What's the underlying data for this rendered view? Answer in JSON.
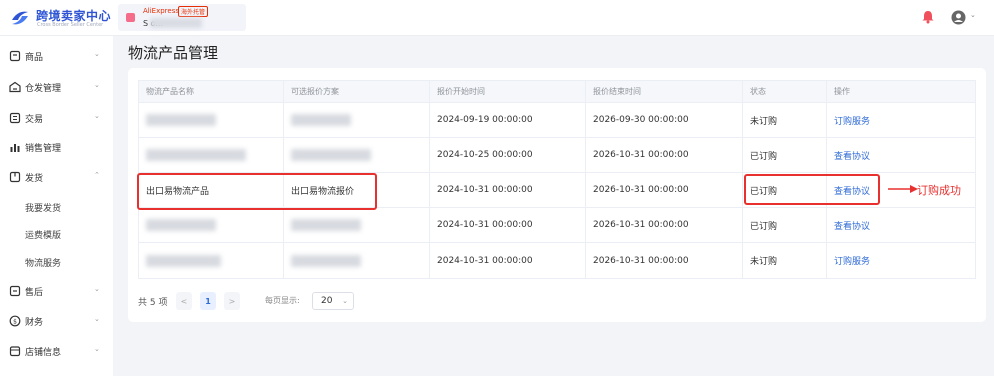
{
  "header": {
    "logo_title": "跨境卖家中心",
    "logo_sub": "Cross Border Seller Center",
    "store_brand": "AliExpress",
    "store_badge": "海外托管",
    "store_name": "S                 o..."
  },
  "sidebar": {
    "items": [
      {
        "label": "商品",
        "icon": "box-icon",
        "caret": "⌄"
      },
      {
        "label": "仓发管理",
        "icon": "warehouse-icon",
        "caret": "⌄"
      },
      {
        "label": "交易",
        "icon": "order-icon",
        "caret": "⌄"
      },
      {
        "label": "销售管理",
        "icon": "chart-icon",
        "caret": ""
      },
      {
        "label": "发货",
        "icon": "shipping-icon",
        "caret": "⌃"
      },
      {
        "label": "我要发货"
      },
      {
        "label": "运费模版"
      },
      {
        "label": "物流服务"
      },
      {
        "label": "售后",
        "icon": "aftersale-icon",
        "caret": "⌄"
      },
      {
        "label": "财务",
        "icon": "finance-icon",
        "caret": "⌄"
      },
      {
        "label": "店铺信息",
        "icon": "store-icon",
        "caret": "⌄"
      }
    ]
  },
  "page": {
    "title": "物流产品管理"
  },
  "table": {
    "columns": [
      "物流产品名称",
      "可选报价方案",
      "报价开始时间",
      "报价结束时间",
      "状态",
      "操作"
    ],
    "rows": [
      {
        "name": "",
        "plan": "",
        "start": "2024-09-19 00:00:00",
        "end": "2026-09-30 00:00:00",
        "status": "未订购",
        "action": "订购服务"
      },
      {
        "name": "",
        "plan": "",
        "start": "2024-10-25 00:00:00",
        "end": "2026-10-31 00:00:00",
        "status": "已订购",
        "action": "查看协议"
      },
      {
        "name": "出口易物流产品",
        "plan": "出口易物流报价",
        "start": "2024-10-31 00:00:00",
        "end": "2026-10-31 00:00:00",
        "status": "已订购",
        "action": "查看协议"
      },
      {
        "name": "",
        "plan": "",
        "start": "2024-10-31 00:00:00",
        "end": "2026-10-31 00:00:00",
        "status": "已订购",
        "action": "查看协议"
      },
      {
        "name": "",
        "plan": "",
        "start": "2024-10-31 00:00:00",
        "end": "2026-10-31 00:00:00",
        "status": "未订购",
        "action": "订购服务"
      }
    ]
  },
  "annotation": {
    "text": "订购成功"
  },
  "pagination": {
    "total": "共 5 项",
    "prev": "<",
    "current": "1",
    "next": ">",
    "per_page_label": "每页显示:",
    "per_page_value": "20"
  },
  "colors": {
    "accent": "#2f6bd6",
    "highlight": "#e8302e",
    "logo": "#2f55d4"
  }
}
